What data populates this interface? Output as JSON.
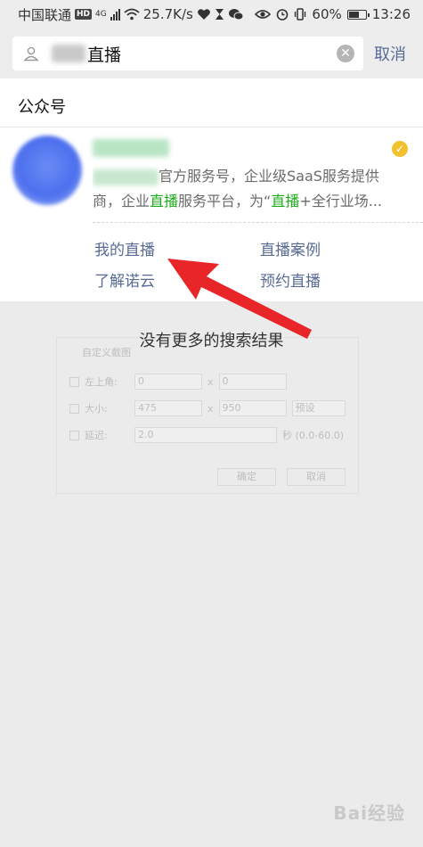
{
  "status_bar": {
    "carrier": "中国联通",
    "hd": "HD",
    "network": "4G",
    "speed": "25.7K/s",
    "battery": "60%",
    "time": "13:26"
  },
  "search": {
    "query": "直播",
    "cancel_label": "取消"
  },
  "results": {
    "section_label": "公众号",
    "account": {
      "desc_part1": "官方服务号，企业级SaaS服务提供",
      "desc_part2_prefix": "商，企业",
      "desc_highlight1": "直播",
      "desc_part2_mid": "服务平台，为“",
      "desc_highlight2": "直播",
      "desc_part2_suffix": "+全行业场..."
    },
    "menu": [
      "我的直播",
      "直播案例",
      "了解诺云",
      "预约直播"
    ]
  },
  "footer_text": "没有更多的搜索结果",
  "ghost_dialog": {
    "title": "自定义截图",
    "row1_label": "左上角:",
    "row1_x": "0",
    "row1_y": "0",
    "row2_label": "大小:",
    "row2_w": "475",
    "row2_h": "950",
    "row2_preset": "预设",
    "row3_label": "延迟:",
    "row3_value": "2.0",
    "row3_unit": "秒 (0.0-60.0)",
    "ok": "确定",
    "cancel": "取消",
    "sep": "x"
  },
  "watermark": "Bai经验",
  "colors": {
    "link": "#576b95",
    "highlight": "#1aad19",
    "arrow": "#e8262a"
  }
}
